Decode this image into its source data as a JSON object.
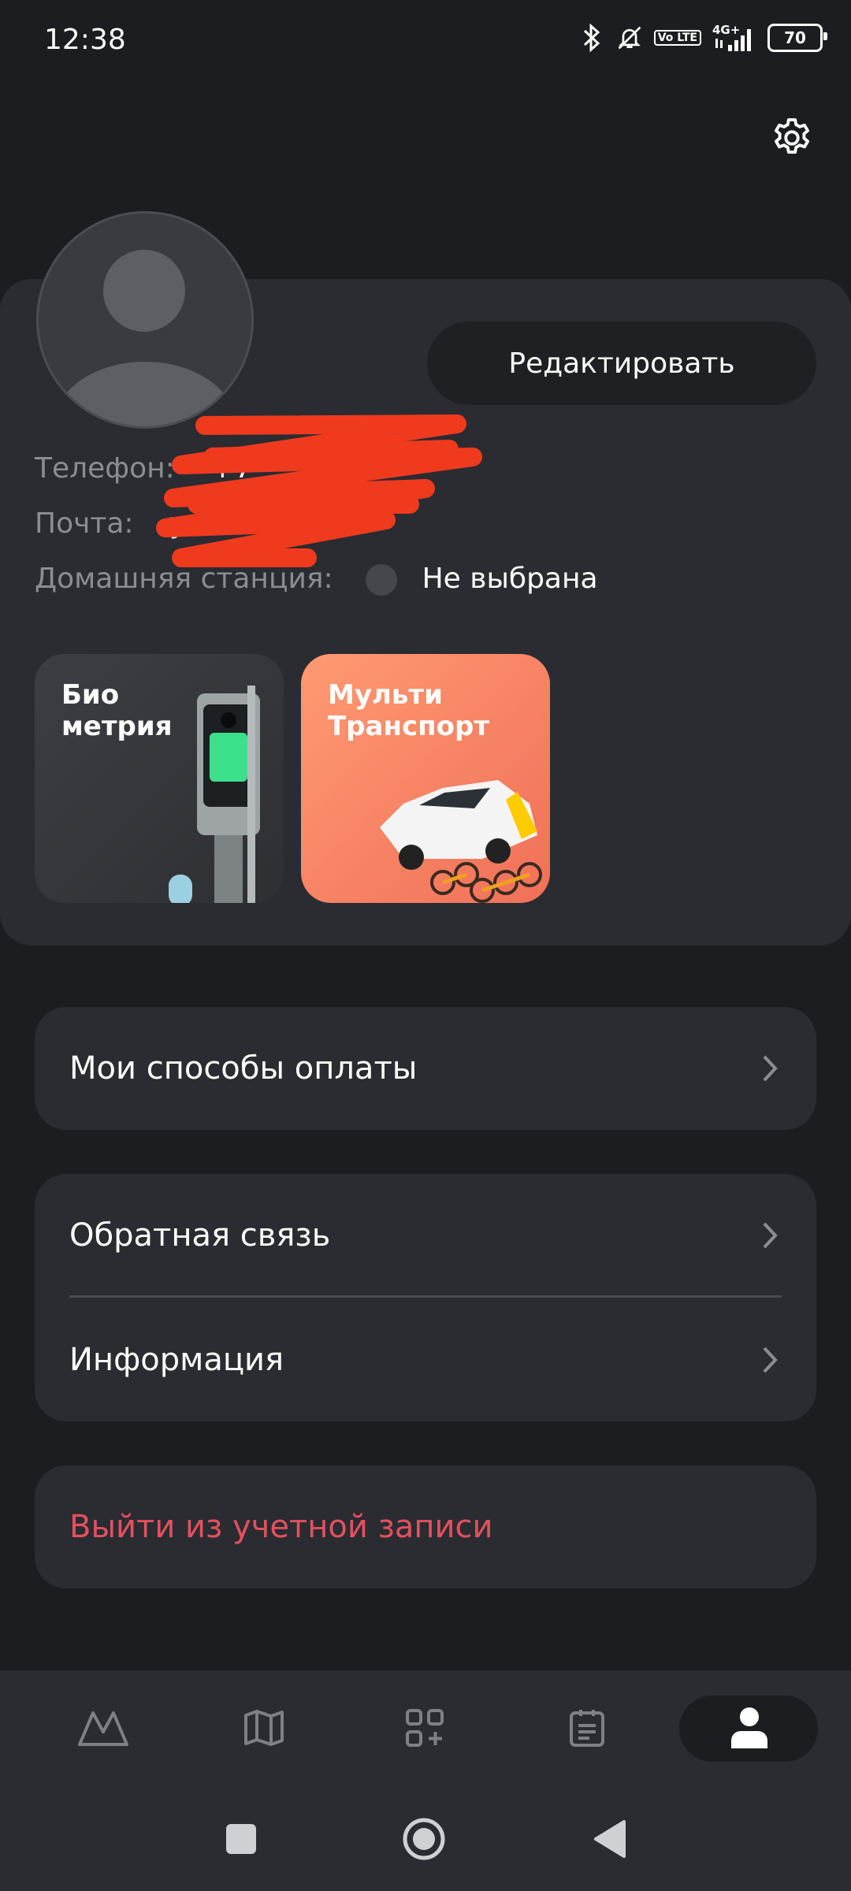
{
  "status_bar": {
    "time": "12:38",
    "network_badge": "Vo LTE",
    "network_type": "4G+",
    "battery": "70",
    "icons": [
      "bluetooth-icon",
      "mute-icon",
      "volte-icon",
      "signal-icon",
      "battery-icon"
    ]
  },
  "profile": {
    "edit_label": "Редактировать",
    "phone_label": "Телефон:",
    "phone_value": "+7",
    "email_label": "Почта:",
    "email_value": "y",
    "station_label": "Домашняя станция:",
    "station_value": "Не выбрана"
  },
  "tiles": [
    {
      "title": "Био метрия",
      "icon": "biometry-terminal-image"
    },
    {
      "title": "Мульти Транспорт",
      "icon": "car-bikes-image"
    }
  ],
  "menu": {
    "payment": "Мои способы оплаты",
    "feedback": "Обратная связь",
    "info": "Информация",
    "logout": "Выйти из учетной записи"
  },
  "bottom_nav": {
    "items": [
      "metro-icon",
      "map-icon",
      "services-icon",
      "tickets-icon",
      "profile-icon"
    ],
    "active": "profile-icon"
  },
  "colors": {
    "background": "#1c1d21",
    "card": "#2a2c31",
    "logout": "#e5505f",
    "multi_tile": "#f07058"
  }
}
